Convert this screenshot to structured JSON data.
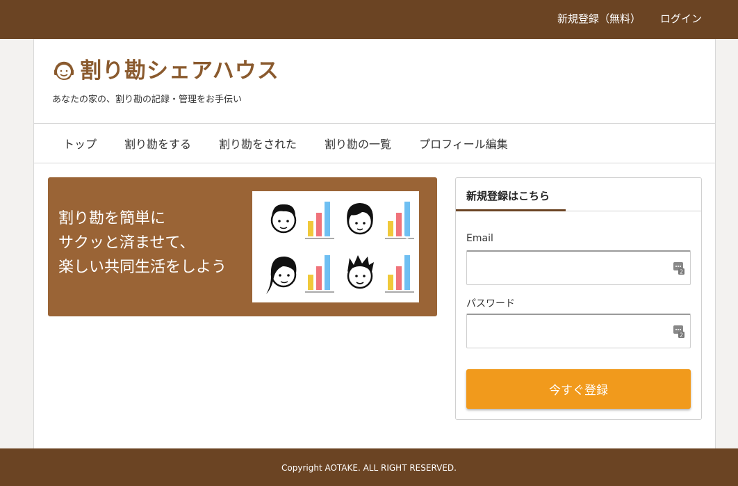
{
  "topbar": {
    "signup_label": "新規登録（無料）",
    "login_label": "ログイン"
  },
  "header": {
    "site_title": "割り勘シェアハウス",
    "tagline": "あなたの家の、割り勘の記録・管理をお手伝い",
    "logo_icon": "headset-face-icon"
  },
  "nav": {
    "items": [
      {
        "label": "トップ"
      },
      {
        "label": "割り勘をする"
      },
      {
        "label": "割り勘をされた"
      },
      {
        "label": "割り勘の一覧"
      },
      {
        "label": "プロフィール編集"
      }
    ]
  },
  "hero": {
    "lines": [
      "割り勘を簡単に",
      "サクッと済ませて、",
      "楽しい共同生活をしよう"
    ],
    "prev_glyph": "‹",
    "next_glyph": "›"
  },
  "register": {
    "title": "新規登録はこちら",
    "email_label": "Email",
    "email_value": "",
    "password_label": "パスワード",
    "password_value": "",
    "submit_label": "今すぐ登録"
  },
  "footer": {
    "copyright": "Copyright AOTAKE. ALL RIGHT RESERVED."
  },
  "colors": {
    "brand_brown": "#6b4423",
    "hero_brown": "#9a6436",
    "accent_orange": "#f19a1c",
    "logo_text": "#8a5a2e"
  }
}
